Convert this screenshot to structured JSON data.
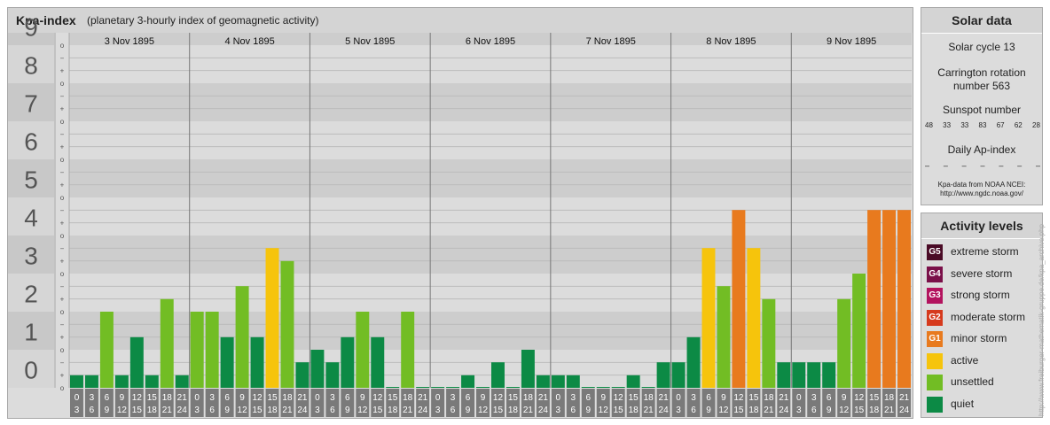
{
  "header": {
    "title": "Kpa-index",
    "subtitle": "(planetary 3-hourly index of geomagnetic activity)"
  },
  "chart_data": {
    "type": "bar",
    "title": "Kpa-index",
    "ylim": [
      0,
      9
    ],
    "y_tick_labels": [
      "0",
      "1",
      "2",
      "3",
      "4",
      "5",
      "6",
      "7",
      "8",
      "9"
    ],
    "y_minor_labels": [
      "−",
      "o",
      "+"
    ],
    "days": [
      "3 Nov 1895",
      "4 Nov 1895",
      "5 Nov 1895",
      "6 Nov 1895",
      "7 Nov 1895",
      "8 Nov 1895",
      "9 Nov 1895"
    ],
    "interval_labels": [
      [
        "0",
        "3"
      ],
      [
        "3",
        "6"
      ],
      [
        "6",
        "9"
      ],
      [
        "9",
        "12"
      ],
      [
        "12",
        "15"
      ],
      [
        "15",
        "18"
      ],
      [
        "18",
        "21"
      ],
      [
        "21",
        "24"
      ]
    ],
    "values": [
      0.33,
      0.33,
      2.0,
      0.33,
      1.33,
      0.33,
      2.33,
      0.33,
      2.0,
      2.0,
      1.33,
      2.67,
      1.33,
      3.67,
      3.33,
      0.67,
      1.0,
      0.67,
      1.33,
      2.0,
      1.33,
      0.0,
      2.0,
      0.0,
      0.0,
      0.0,
      0.33,
      0.0,
      0.67,
      0.0,
      1.0,
      0.33,
      0.33,
      0.33,
      0.0,
      0.0,
      0.0,
      0.33,
      0.0,
      0.67,
      0.67,
      1.33,
      3.67,
      2.67,
      4.67,
      3.67,
      2.33,
      0.67,
      0.67,
      0.67,
      0.67,
      2.33,
      3.0,
      4.67,
      4.67,
      4.67
    ],
    "color_thresholds": {
      "quiet_below": 2.0,
      "unsettled_below": 3.67,
      "active_below": 4.67
    },
    "grid": true
  },
  "solar": {
    "title": "Solar data",
    "solar_cycle": "Solar cycle 13",
    "carrington_line1": "Carrington rotation",
    "carrington_line2": "number 563",
    "sunspot_title": "Sunspot number",
    "sunspot_values": [
      "48",
      "33",
      "33",
      "83",
      "67",
      "62",
      "28"
    ],
    "ap_title": "Daily Ap-index",
    "ap_values": [
      "–",
      "–",
      "–",
      "–",
      "–",
      "–",
      "–"
    ],
    "credit_line1": "Kpa-data from NOAA NCEI:",
    "credit_line2": "http://www.ngdc.noaa.gov/"
  },
  "legend": {
    "title": "Activity levels",
    "items": [
      {
        "code": "G5",
        "label": "extreme storm",
        "color": "#4a0b26"
      },
      {
        "code": "G4",
        "label": "severe storm",
        "color": "#7a1049"
      },
      {
        "code": "G3",
        "label": "strong storm",
        "color": "#b3135e"
      },
      {
        "code": "G2",
        "label": "moderate storm",
        "color": "#d63a1d"
      },
      {
        "code": "G1",
        "label": "minor storm",
        "color": "#e87a1e"
      },
      {
        "code": "",
        "label": "active",
        "color": "#f6c40c"
      },
      {
        "code": "",
        "label": "unsettled",
        "color": "#72bd24"
      },
      {
        "code": "",
        "label": "quiet",
        "color": "#0c8a45"
      }
    ]
  },
  "side_credit": "http://www.freiburger-mathematik-gruppe.de/kpa_archive.php"
}
